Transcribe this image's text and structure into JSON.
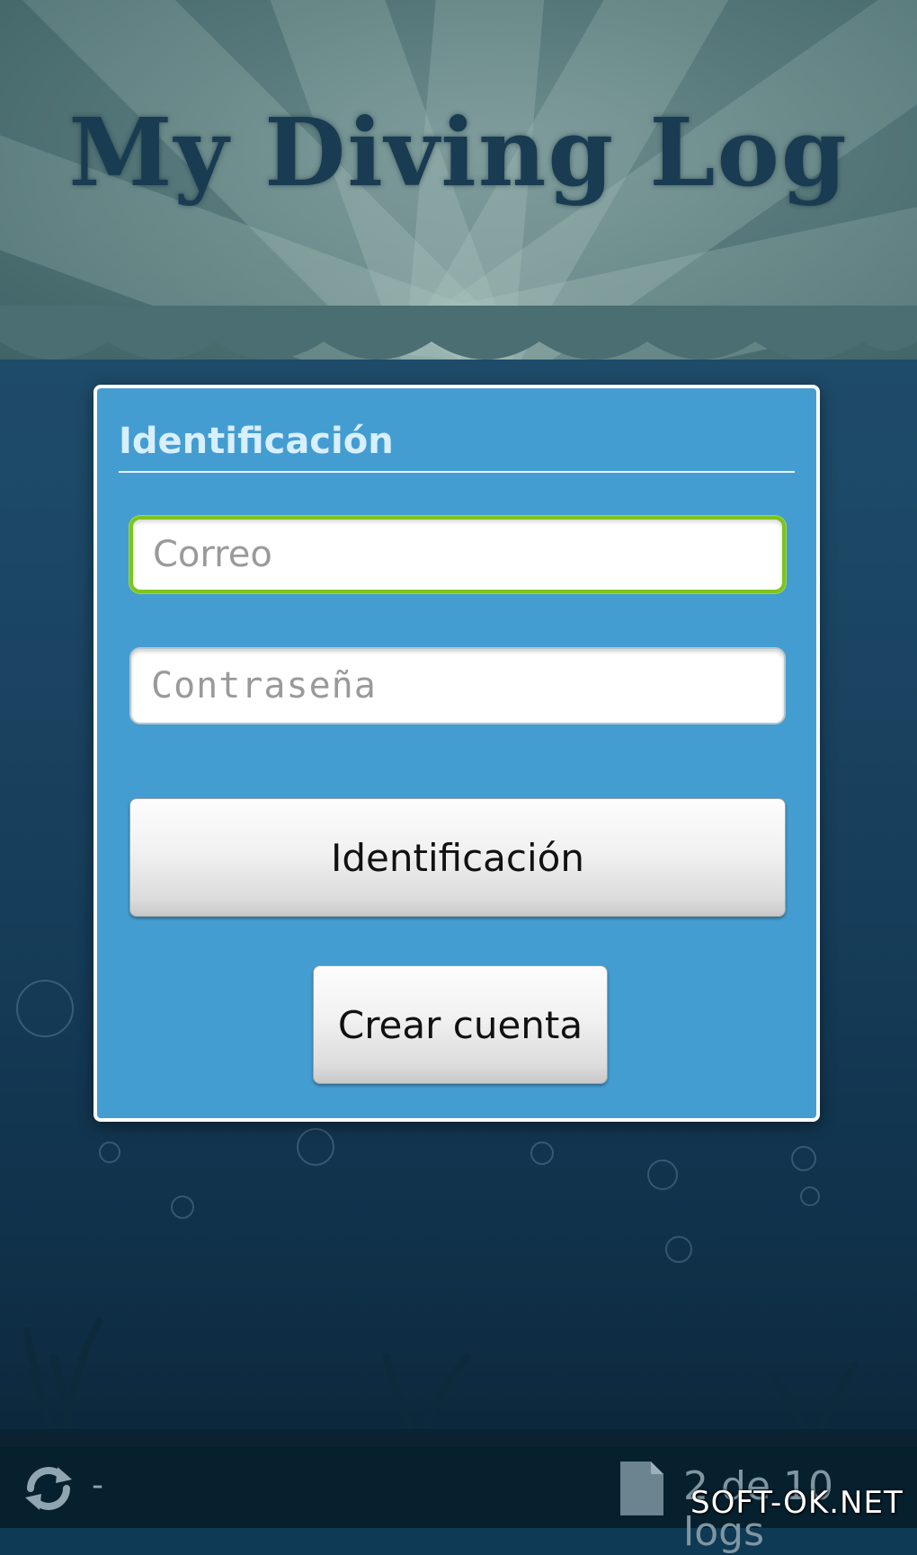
{
  "app": {
    "title": "My Diving Log"
  },
  "dialog": {
    "title": "Identificación",
    "email_placeholder": "Correo",
    "password_placeholder": "Contraseña",
    "login_button": "Identificación",
    "create_account_button": "Crear cuenta"
  },
  "bottom_bar": {
    "sync_icon": "sync-icon",
    "sync_status": "-",
    "doc_icon": "document-icon",
    "logs_count": "2 de 10 logs"
  },
  "watermark": "SOFT-OK.NET",
  "colors": {
    "dialog_background": "#449dd1",
    "dialog_title": "#d8efff",
    "focus_border": "#7fc31f",
    "title_text": "#1a3c52"
  }
}
